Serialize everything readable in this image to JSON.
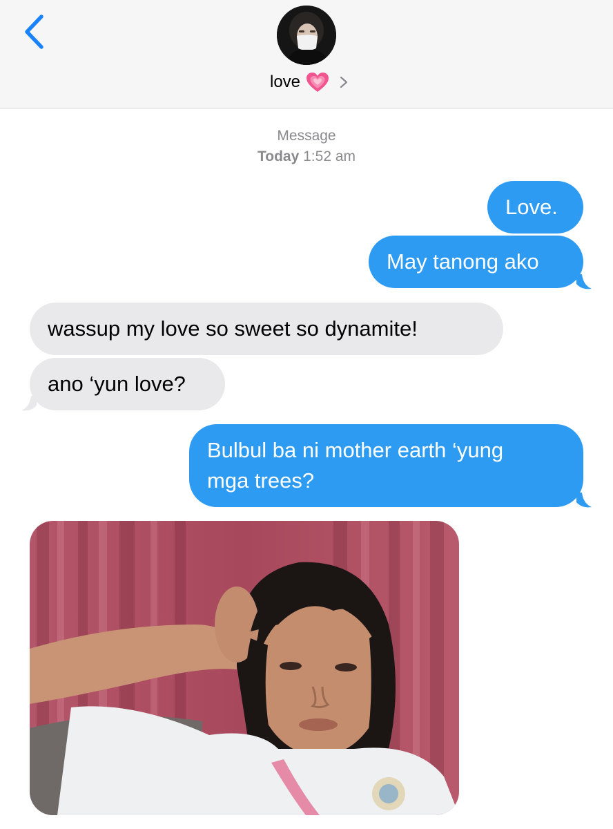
{
  "header": {
    "back_icon": "chevron-left-icon",
    "contact_name": "love",
    "name_emoji_icon": "growing-heart-icon",
    "disclosure_icon": "chevron-right-icon"
  },
  "meta": {
    "service": "Message",
    "day": "Today",
    "time": "1:52 am"
  },
  "messages": [
    {
      "direction": "sent",
      "text": "Love."
    },
    {
      "direction": "sent",
      "text": "May tanong ako"
    },
    {
      "direction": "received",
      "text": "wassup my love so sweet so dynamite!"
    },
    {
      "direction": "received",
      "text": "ano ‘yun love?"
    },
    {
      "direction": "sent",
      "lines": [
        "Bulbul ba ni mother earth ‘yung",
        "mga trees?"
      ]
    },
    {
      "direction": "received",
      "type": "photo"
    }
  ],
  "colors": {
    "accent_blue": "#2e9bf3",
    "back_blue": "#1a82fb",
    "received_gray": "#e9e9eb",
    "header_bg": "#f6f6f6",
    "meta_gray": "#8a8a8e",
    "heart_pink": "#f0558f"
  }
}
